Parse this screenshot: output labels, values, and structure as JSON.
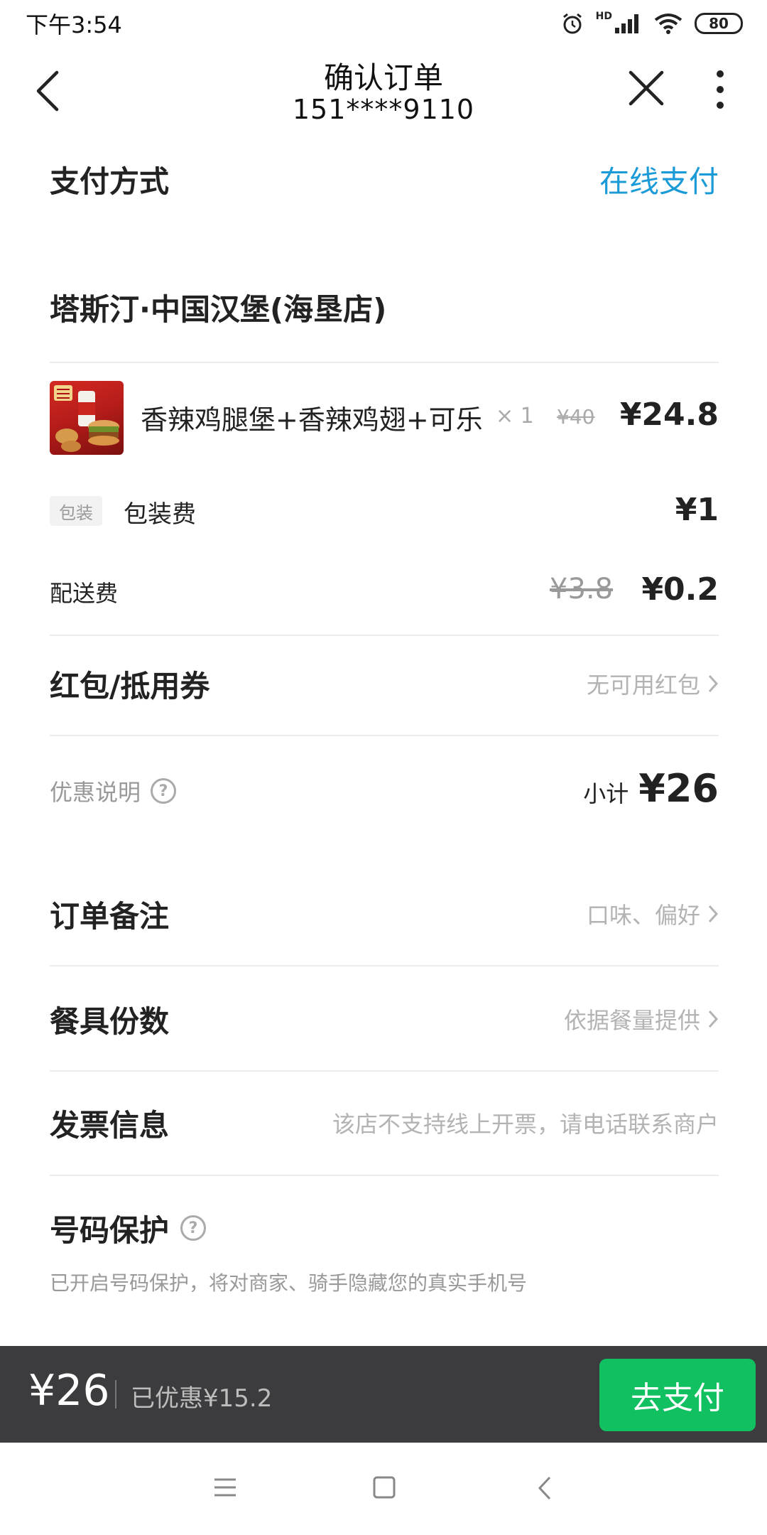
{
  "status_bar": {
    "time": "下午3:54",
    "network_badge": "HD",
    "battery": "80",
    "icons": [
      "alarm-icon",
      "signal-icon",
      "wifi-icon",
      "battery-icon"
    ]
  },
  "nav": {
    "title": "确认订单",
    "subtitle": "151****9110",
    "icons": [
      "back-icon",
      "close-icon",
      "more-icon"
    ]
  },
  "payment": {
    "label": "支付方式",
    "value": "在线支付",
    "value_color": "#1a9ad6"
  },
  "store": {
    "name": "塔斯汀·中国汉堡(海垦店)"
  },
  "order_item": {
    "name": "香辣鸡腿堡+香辣鸡翅+可乐",
    "quantity": "× 1",
    "original_price": "¥40",
    "price": "¥24.8"
  },
  "packaging": {
    "tag": "包装",
    "label": "包装费",
    "price": "¥1"
  },
  "delivery": {
    "label": "配送费",
    "original_price": "¥3.8",
    "price": "¥0.2"
  },
  "coupon": {
    "label": "红包/抵用券",
    "value": "无可用红包"
  },
  "discount": {
    "label": "优惠说明",
    "help": "?",
    "subtotal_label": "小计",
    "subtotal_value": "¥26"
  },
  "remarks": {
    "label": "订单备注",
    "value": "口味、偏好"
  },
  "utensils": {
    "label": "餐具份数",
    "value": "依据餐量提供"
  },
  "invoice": {
    "label": "发票信息",
    "value": "该店不支持线上开票，请电话联系商户"
  },
  "phone_protection": {
    "label": "号码保护",
    "help": "?",
    "description": "已开启号码保护，将对商家、骑手隐藏您的真实手机号"
  },
  "bottom_bar": {
    "total": "¥26",
    "saved": "已优惠¥15.2",
    "pay_button": "去支付",
    "pay_color": "#11c161"
  },
  "system_nav": {
    "icons": [
      "menu-icon",
      "home-icon",
      "back-icon"
    ]
  }
}
